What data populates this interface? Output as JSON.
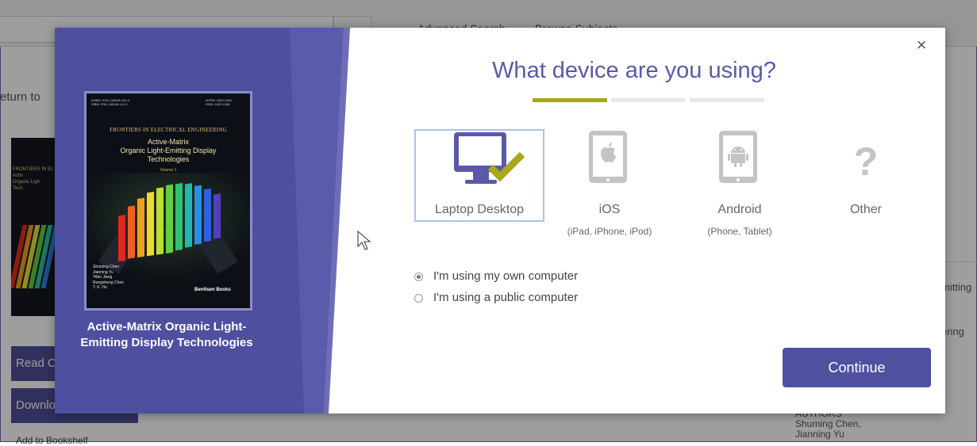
{
  "background": {
    "nav_links": [
      "Advanced Search",
      "Browse Subjects"
    ],
    "return_text": "eturn to",
    "read_button": "Read O",
    "download_button": "Downlo",
    "add_bookshelf": "Add to Bookshelf",
    "right_text_1": "mitting",
    "right_text_2": "ering",
    "authors_label": "AUTHORS",
    "authors_names": "Shuming Chen,",
    "authors_names_2": "Jianning Yu"
  },
  "modal": {
    "close_symbol": "×",
    "heading": "What device are you using?",
    "steps": {
      "total": 3,
      "active": 1
    },
    "book": {
      "title": "Active-Matrix Organic Light-Emitting Display Technologies",
      "cover_series": "FRONTIERS IN ELECTRICAL ENGINEERING",
      "cover_title_1": "Active-Matrix",
      "cover_title_2": "Organic Light-Emitting Display",
      "cover_title_3": "Technologies",
      "cover_volume": "Volume 1",
      "cover_authors": [
        "Shuming Chen",
        "Jianning Yu",
        "Yibin Jiang",
        "Rongsheng Chen",
        "T. K. Ho"
      ],
      "cover_publisher": "Bentham Books",
      "cover_isbn_left": "eISBN: 978-1-68108-140-4\nISBN: 978-1-68108-141-1",
      "cover_isbn_right": "eISSN: 2452-1000\nISSN: 2452-1108"
    },
    "devices": [
      {
        "label": "Laptop Desktop",
        "sub": "",
        "icon": "monitor-check-icon",
        "selected": true
      },
      {
        "label": "iOS",
        "sub": "(iPad, iPhone, iPod)",
        "icon": "apple-tablet-icon",
        "selected": false
      },
      {
        "label": "Android",
        "sub": "(Phone, Tablet)",
        "icon": "android-tablet-icon",
        "selected": false
      },
      {
        "label": "Other",
        "sub": "",
        "icon": "question-mark-icon",
        "selected": false
      }
    ],
    "radio_options": [
      {
        "label": "I'm using my own computer",
        "checked": true
      },
      {
        "label": "I'm using a public computer",
        "checked": false
      }
    ],
    "continue_label": "Continue",
    "colors": {
      "accent": "#5050a0",
      "panel": "#4f4f9f",
      "step_active": "#a8a818",
      "step_inactive": "#e8e8e8",
      "check": "#a8a818"
    }
  }
}
